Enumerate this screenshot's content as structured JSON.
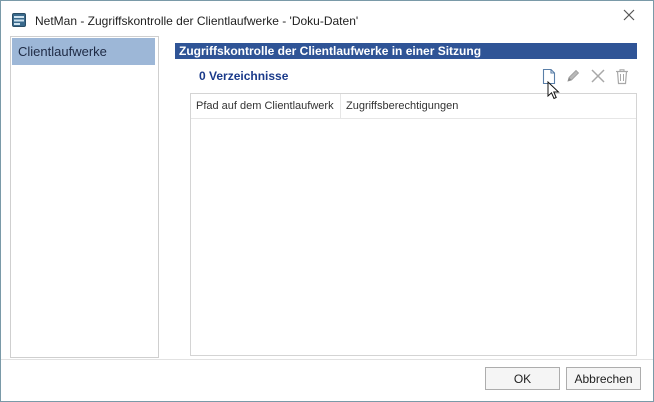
{
  "window": {
    "title": "NetMan - Zugriffskontrolle der Clientlaufwerke - 'Doku-Daten'",
    "icons": {
      "app": "netman-app-icon",
      "close": "close-icon"
    }
  },
  "sidebar": {
    "items": [
      {
        "label": "Clientlaufwerke",
        "selected": true
      }
    ]
  },
  "content": {
    "header": "Zugriffskontrolle der Clientlaufwerke in einer Sitzung",
    "count_label": "0 Verzeichnisse",
    "toolbar": {
      "new": "new-document-icon",
      "edit": "pencil-icon",
      "delete": "x-icon",
      "trash": "trash-icon"
    },
    "table": {
      "columns": [
        "Pfad auf dem Clientlaufwerk",
        "Zugriffsberechtigungen"
      ],
      "rows": []
    }
  },
  "footer": {
    "ok_label": "OK",
    "cancel_label": "Abbrechen"
  },
  "colors": {
    "header_bg": "#2f5496",
    "selected_bg": "#9db7d7",
    "count_text": "#1a3a8a"
  }
}
